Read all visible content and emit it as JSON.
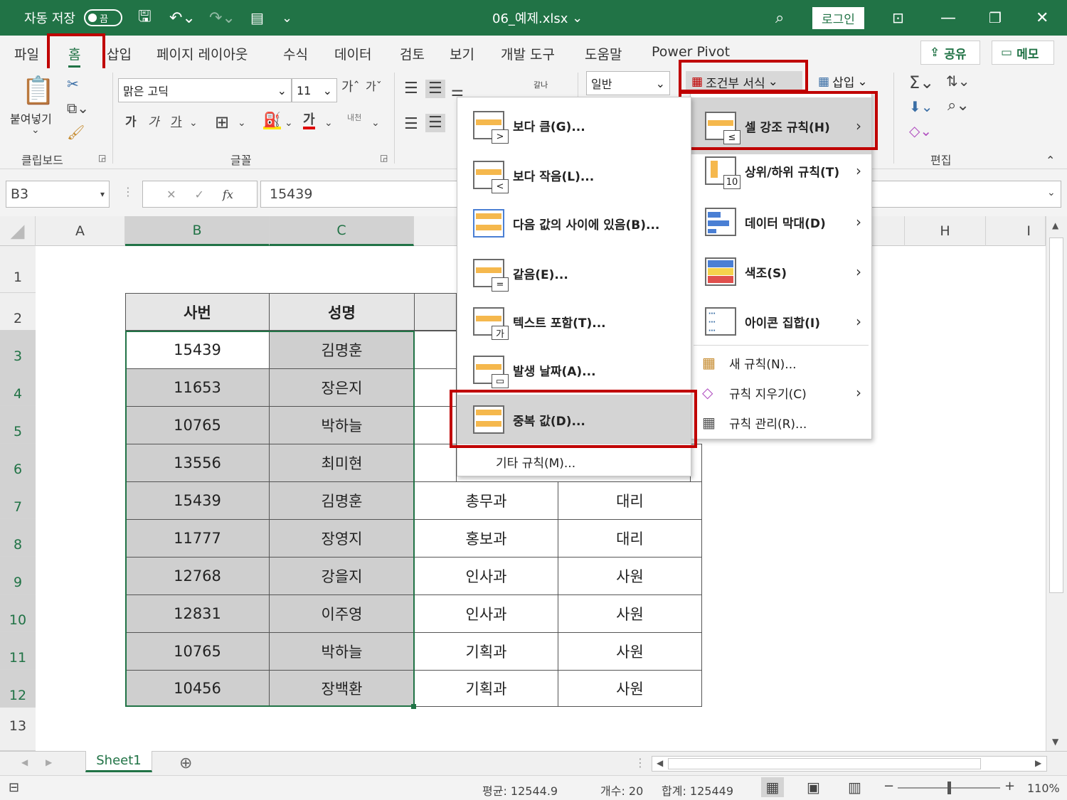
{
  "titlebar": {
    "autosave_label": "자동 저장",
    "autosave_state": "끔",
    "filename": "06_예제.xlsx",
    "login_label": "로그인",
    "accent_color": "#217346"
  },
  "tabs": {
    "items": [
      "파일",
      "홈",
      "삽입",
      "페이지 레이아웃",
      "수식",
      "데이터",
      "검토",
      "보기",
      "개발 도구",
      "도움말",
      "Power Pivot"
    ],
    "active": "홈",
    "share_label": "공유",
    "memo_label": "메모"
  },
  "ribbon": {
    "paste_label": "붙여넣기",
    "clipboard_group": "클립보드",
    "font_name": "맑은 고딕",
    "font_size": "11",
    "font_group": "글꼴",
    "number_format": "일반",
    "cond_format_label": "조건부 서식",
    "insert_label": "삽입",
    "edit_group": "편집",
    "font_grow": "가",
    "font_shrink": "가",
    "bold": "가",
    "italic": "가",
    "underline": "가",
    "font_color": "가",
    "phonetic": "내천",
    "wrap": "갈나"
  },
  "formula_bar": {
    "name_box": "B3",
    "value": "15439"
  },
  "columns": [
    "A",
    "B",
    "C",
    "H",
    "I"
  ],
  "rows": [
    "1",
    "2",
    "3",
    "4",
    "5",
    "6",
    "7",
    "8",
    "9",
    "10",
    "11",
    "12",
    "13"
  ],
  "table": {
    "headers": [
      "사번",
      "성명"
    ],
    "ids": [
      "15439",
      "11653",
      "10765",
      "13556",
      "15439",
      "11777",
      "12768",
      "12831",
      "10765",
      "10456"
    ],
    "names": [
      "김명훈",
      "장은지",
      "박하늘",
      "최미현",
      "김명훈",
      "장영지",
      "강을지",
      "이주영",
      "박하늘",
      "장백환"
    ],
    "dept": [
      "총무과",
      "홍보과",
      "인사과",
      "인사과",
      "기획과",
      "기획과"
    ],
    "rank": [
      "대리",
      "대리",
      "사원",
      "사원",
      "사원",
      "사원"
    ]
  },
  "cond_menu": {
    "items": [
      "셀 강조 규칙(H)",
      "상위/하위 규칙(T)",
      "데이터 막대(D)",
      "색조(S)",
      "아이콘 집합(I)",
      "새 규칙(N)...",
      "규칙 지우기(C)",
      "규칙 관리(R)..."
    ]
  },
  "highlight_menu": {
    "items": [
      "보다 큼(G)...",
      "보다 작음(L)...",
      "다음 값의 사이에 있음(B)...",
      "같음(E)...",
      "텍스트 포함(T)...",
      "발생 날짜(A)...",
      "중복 값(D)...",
      "기타 규칙(M)..."
    ]
  },
  "sheet": {
    "tab_name": "Sheet1"
  },
  "status": {
    "average": "평균: 12544.9",
    "count": "개수: 20",
    "sum": "합계: 125449",
    "zoom": "110%"
  }
}
